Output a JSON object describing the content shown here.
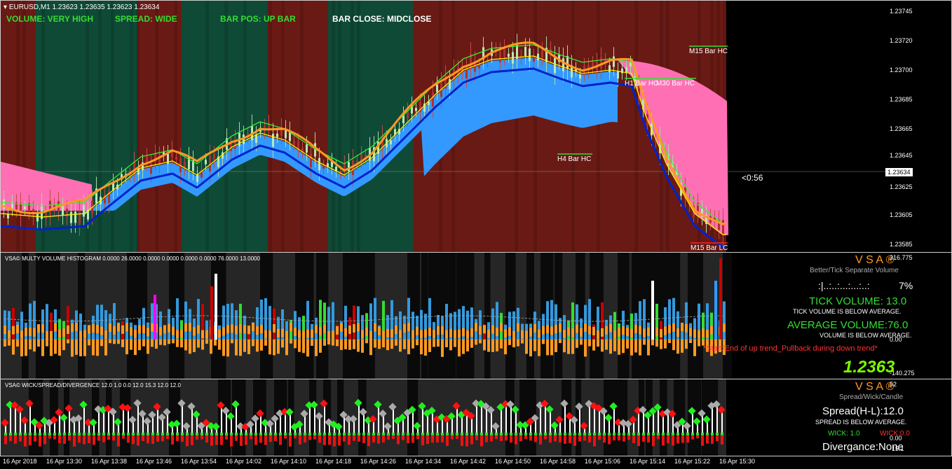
{
  "main": {
    "symbol_title": "EURUSD,M1  1.23623 1.23635 1.23623 1.23634",
    "status": [
      {
        "text": "VOLUME: VERY HIGH",
        "color": "#33dd33"
      },
      {
        "text": "SPREAD: WIDE",
        "color": "#33dd33"
      },
      {
        "text": "BAR POS: UP BAR",
        "color": "#33dd33"
      },
      {
        "text": "BAR CLOSE: MIDCLOSE",
        "color": "#ffffff"
      }
    ],
    "level_labels": [
      "M15 Bar HC",
      "H1 Bar HC",
      "M30 Bar HC",
      "H4 Bar HC",
      "M15 Bar LC"
    ],
    "countdown": "<0:56",
    "current_price": "1.23634",
    "price_ticks": [
      "1.23745",
      "1.23720",
      "1.23700",
      "1.23685",
      "1.23665",
      "1.23645",
      "1.23625",
      "1.23605",
      "1.23585"
    ]
  },
  "volume": {
    "title": "VSA© MULTY VOLUME HISTOGRAM 0.0000 26.0000 0.0000 0.0000 0.0000 0.0000 76.0000 13.0000",
    "brand": "V S A ®",
    "subtitle": "Better/Tick Separate Volume",
    "dots": ":|..:..:...:...:..:",
    "pct": "7%",
    "tick_volume": "TICK VOLUME: 13.0",
    "tick_note": "TICK VOLUME IS BELOW AVERAGE.",
    "avg_volume": "AVERAGE VOLUME:76.0",
    "avg_note": "VOLUME IS BELOW AVERAGE.",
    "trend_note": "*Start/End of up trend_Pullback during down trend*",
    "big_price": "1.2363",
    "ticks": [
      "316.775",
      "0.00",
      "-140.275"
    ]
  },
  "wick": {
    "title": "VSA© WICK/SPREAD/DIVERGENCE 12.0 1.0 0.0 12.0 15.3 12.0 12.0",
    "brand": "V S A ®",
    "subtitle": "Spread/Wick/Candle",
    "spread": "Spread(H-L):12.0",
    "spread_note": "SPREAD IS BELOW AVERAGE.",
    "wick_up": "WICK: 1.0",
    "wick_down": "WICK:0.0",
    "divergence": "Divergance:None",
    "ticks": [
      "52",
      "0.00",
      "-15.1"
    ]
  },
  "time_axis": [
    "16 Apr 2018",
    "16 Apr 13:30",
    "16 Apr 13:38",
    "16 Apr 13:46",
    "16 Apr 13:54",
    "16 Apr 14:02",
    "16 Apr 14:10",
    "16 Apr 14:18",
    "16 Apr 14:26",
    "16 Apr 14:34",
    "16 Apr 14:42",
    "16 Apr 14:50",
    "16 Apr 14:58",
    "16 Apr 15:06",
    "16 Apr 15:14",
    "16 Apr 15:22",
    "16 Apr 15:30"
  ],
  "colors": {
    "bull_zone": "#0f4a36",
    "bear_zone": "#6a1a14",
    "cloud_up": "#3399ff",
    "cloud_down": "#ff6fb4",
    "fast_line": "#0022cc",
    "slow_line": "#ff9922",
    "signal_green": "#33dd33"
  }
}
